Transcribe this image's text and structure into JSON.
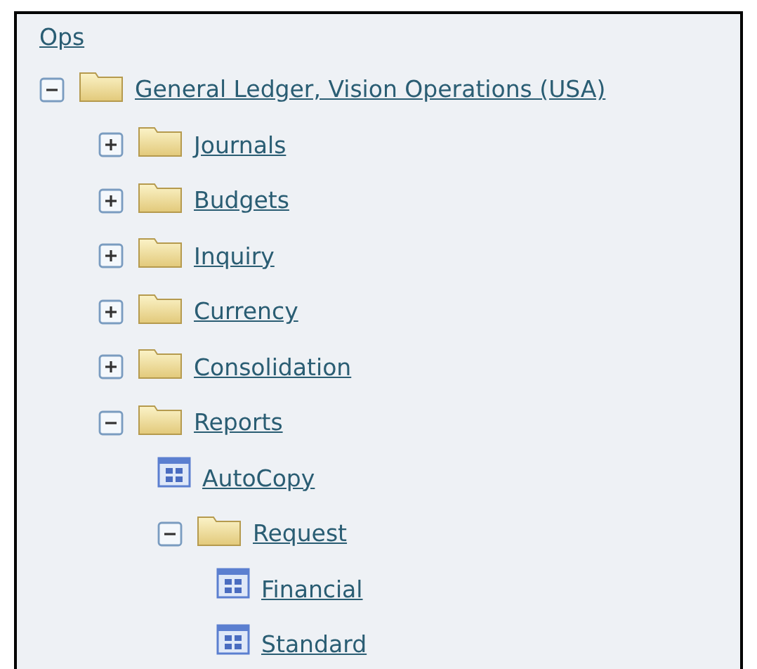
{
  "root_link": "Ops",
  "tree": [
    {
      "kind": "folder",
      "label": "General Ledger, Vision Operations (USA)",
      "expanded": true,
      "children": [
        {
          "kind": "folder",
          "label": "Journals",
          "expanded": false
        },
        {
          "kind": "folder",
          "label": "Budgets",
          "expanded": false
        },
        {
          "kind": "folder",
          "label": "Inquiry",
          "expanded": false
        },
        {
          "kind": "folder",
          "label": "Currency",
          "expanded": false
        },
        {
          "kind": "folder",
          "label": "Consolidation",
          "expanded": false
        },
        {
          "kind": "folder",
          "label": "Reports",
          "expanded": true,
          "children": [
            {
              "kind": "function",
              "label": "AutoCopy"
            },
            {
              "kind": "folder",
              "label": "Request",
              "expanded": true,
              "children": [
                {
                  "kind": "function",
                  "label": "Financial"
                },
                {
                  "kind": "function",
                  "label": "Standard"
                }
              ]
            }
          ]
        }
      ]
    }
  ]
}
